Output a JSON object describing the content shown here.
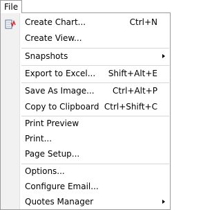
{
  "menubar": {
    "file_label": "File"
  },
  "menu": {
    "items": [
      {
        "label": "Create Chart...",
        "shortcut": "Ctrl+N",
        "icon": "chart-icon"
      },
      {
        "label": "Create View...",
        "shortcut": ""
      },
      {
        "label": "Snapshots",
        "shortcut": "",
        "submenu": true
      },
      {
        "label": "Export to Excel...",
        "shortcut": "Shift+Alt+E"
      },
      {
        "label": "Save As Image...",
        "shortcut": "Ctrl+Alt+P"
      },
      {
        "label": "Copy to Clipboard",
        "shortcut": "Ctrl+Shift+C"
      },
      {
        "label": "Print Preview",
        "shortcut": ""
      },
      {
        "label": "Print...",
        "shortcut": ""
      },
      {
        "label": "Page Setup...",
        "shortcut": ""
      },
      {
        "label": "Options...",
        "shortcut": ""
      },
      {
        "label": "Configure Email...",
        "shortcut": ""
      },
      {
        "label": "Quotes Manager",
        "shortcut": "",
        "submenu": true
      }
    ]
  }
}
